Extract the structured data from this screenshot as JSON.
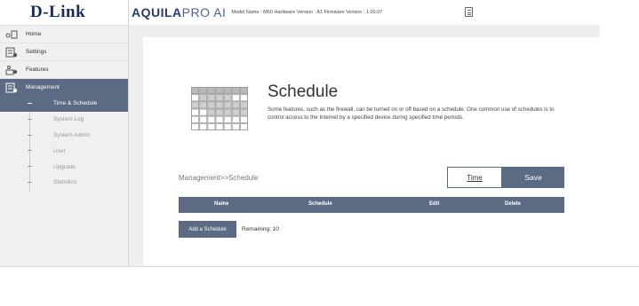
{
  "logo": "D-Link",
  "header": {
    "brand_main": "AQUILA",
    "brand_pro": "PRO AI",
    "model_info": "Model Name : M60 Hardware Version : A1 Firmware Version : 1.00.07"
  },
  "sidebar": {
    "items": [
      {
        "label": "Home",
        "icon": "home-icon"
      },
      {
        "label": "Settings",
        "icon": "settings-icon"
      },
      {
        "label": "Features",
        "icon": "features-icon"
      },
      {
        "label": "Management",
        "icon": "management-icon"
      }
    ],
    "subitems": [
      {
        "label": "Time & Schedule"
      },
      {
        "label": "System Log"
      },
      {
        "label": "System Admin"
      },
      {
        "label": "User"
      },
      {
        "label": "Upgrade"
      },
      {
        "label": "Statistics"
      }
    ]
  },
  "main": {
    "title": "Schedule",
    "description": "Some features, such as the firewall, can be turned on or off based on a schedule. One common use of schedules is to control access to the Internet by a specified device during specified time periods.",
    "breadcrumb": "Management>>Schedule",
    "time_button": "Time",
    "save_button": "Save",
    "table": {
      "headers": [
        "Name",
        "Schedule",
        "Edit",
        "Delete"
      ]
    },
    "add_button": "Add a Schedule",
    "remaining": "Remaining: 10"
  },
  "colors": {
    "accent": "#5a6b83",
    "panel": "#eeeeee",
    "brand": "#2a3c6a"
  }
}
